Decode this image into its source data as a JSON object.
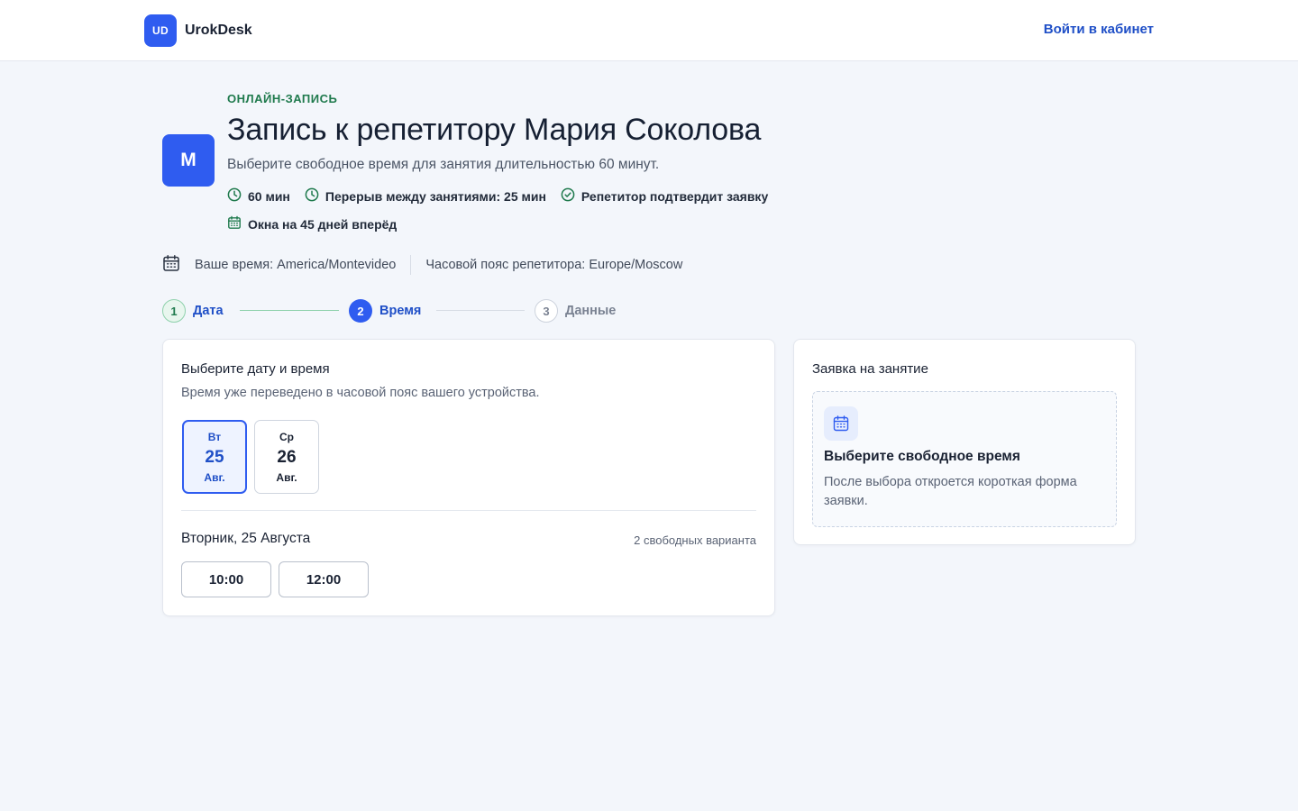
{
  "header": {
    "logo_text": "UD",
    "brand_name": "UrokDesk",
    "login_label": "Войти в кабинет"
  },
  "hero": {
    "avatar_letter": "М",
    "eyebrow": "ОНЛАЙН-ЗАПИСЬ",
    "title": "Запись к репетитору Мария Соколова",
    "subtitle": "Выберите свободное время для занятия длительностью 60 минут.",
    "meta": [
      {
        "icon": "clock-icon",
        "text": "60 мин"
      },
      {
        "icon": "clock-icon",
        "text": "Перерыв между занятиями: 25 мин"
      },
      {
        "icon": "check-circle-icon",
        "text": "Репетитор подтвердит заявку"
      },
      {
        "icon": "calendar-icon",
        "text": "Окна на 45 дней вперёд"
      }
    ]
  },
  "timezone": {
    "icon": "calendar-icon",
    "user_tz": "Ваше время: America/Montevideo",
    "tutor_tz": "Часовой пояс репетитора: Europe/Moscow"
  },
  "steps": [
    {
      "number": "1",
      "label": "Дата",
      "state": "done"
    },
    {
      "number": "2",
      "label": "Время",
      "state": "active"
    },
    {
      "number": "3",
      "label": "Данные",
      "state": "pending"
    }
  ],
  "picker": {
    "title": "Выберите дату и время",
    "subtitle": "Время уже переведено в часовой пояс вашего устройства.",
    "dates": [
      {
        "dow": "Вт",
        "day": "25",
        "month": "Авг.",
        "selected": true
      },
      {
        "dow": "Ср",
        "day": "26",
        "month": "Авг.",
        "selected": false
      }
    ],
    "selected_day_label": "Вторник, 25 Августа",
    "slot_count": "2 свободных варианта",
    "slots": [
      "10:00",
      "12:00"
    ]
  },
  "summary": {
    "title": "Заявка на занятие",
    "empty_icon": "calendar-icon",
    "empty_title": "Выберите свободное время",
    "empty_text": "После выбора откроется короткая форма заявки."
  },
  "colors": {
    "accent": "#2f5cf0",
    "link": "#1f4fc7",
    "success": "#1f7a4d",
    "background": "#f3f6fb"
  }
}
